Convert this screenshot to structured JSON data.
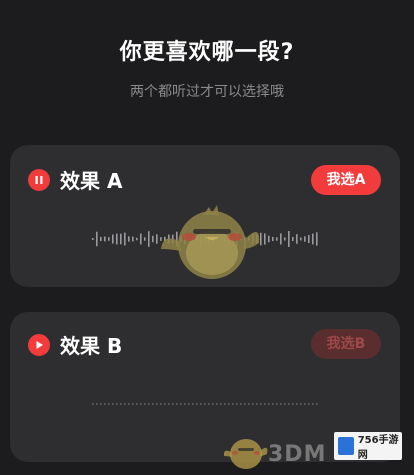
{
  "header": {
    "title": "你更喜欢哪一段?",
    "subtitle": "两个都听过才可以选择哦"
  },
  "cards": [
    {
      "label": "效果 A",
      "button": "我选A",
      "state": "playing"
    },
    {
      "label": "效果 B",
      "button": "我选B",
      "state": "paused"
    }
  ],
  "watermark": "3DM",
  "site_badge": "756手游网",
  "colors": {
    "background": "#1c1c1e",
    "card": "#2e2e30",
    "accent": "#f23b3b",
    "accent_disabled": "#5a2e2e"
  },
  "icons": {
    "card_a_control": "pause-icon",
    "card_b_control": "play-icon",
    "mascot": "duck-mascot"
  }
}
